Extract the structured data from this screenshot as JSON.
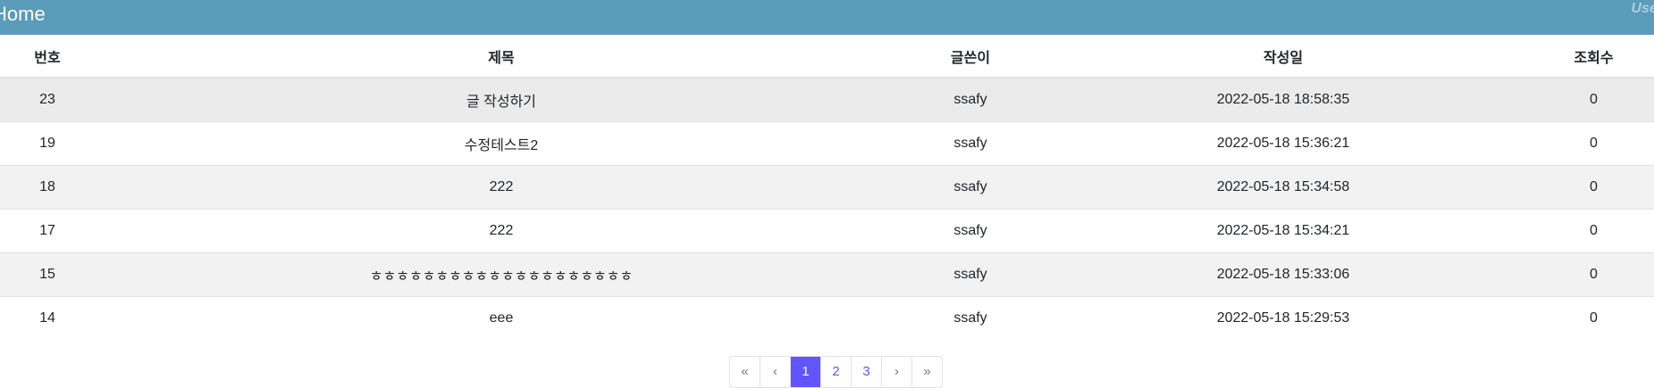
{
  "header": {
    "brand": "Home",
    "user": "User"
  },
  "table": {
    "columns": [
      "번호",
      "제목",
      "글쓴이",
      "작성일",
      "조회수"
    ],
    "rows": [
      [
        "23",
        "글 작성하기",
        "ssafy",
        "2022-05-18 18:58:35",
        "0"
      ],
      [
        "19",
        "수정테스트2",
        "ssafy",
        "2022-05-18 15:36:21",
        "0"
      ],
      [
        "18",
        "222",
        "ssafy",
        "2022-05-18 15:34:58",
        "0"
      ],
      [
        "17",
        "222",
        "ssafy",
        "2022-05-18 15:34:21",
        "0"
      ],
      [
        "15",
        "ㅎㅎㅎㅎㅎㅎㅎㅎㅎㅎㅎㅎㅎㅎㅎㅎㅎㅎㅎㅎ",
        "ssafy",
        "2022-05-18 15:33:06",
        "0"
      ],
      [
        "14",
        "eee",
        "ssafy",
        "2022-05-18 15:29:53",
        "0"
      ]
    ]
  },
  "pagination": {
    "first": "«",
    "prev": "‹",
    "pages": [
      "1",
      "2",
      "3"
    ],
    "next": "›",
    "last": "»",
    "current": "1"
  }
}
